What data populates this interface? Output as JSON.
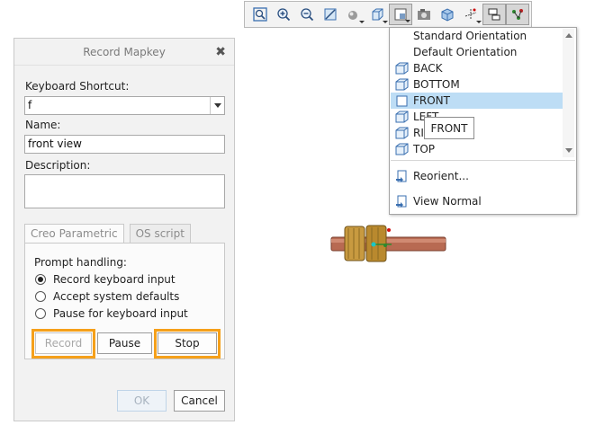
{
  "toolbar": {
    "icons": [
      "zoom-fit-icon",
      "zoom-in-icon",
      "zoom-out-icon",
      "repaint-icon",
      "display-style-icon",
      "saved-orientations-icon",
      "named-views-icon",
      "view-manager-icon",
      "spin-center-icon",
      "datum-display-icon",
      "annotation-display-icon",
      "appearance-icon"
    ]
  },
  "dialog": {
    "title": "Record Mapkey",
    "close_glyph": "✖",
    "shortcut_label": "Keyboard Shortcut:",
    "shortcut_value": "f",
    "name_label": "Name:",
    "name_value": "front view",
    "description_label": "Description:",
    "description_value": "",
    "tabs": [
      {
        "label": "Creo Parametric"
      },
      {
        "label": "OS script"
      }
    ],
    "prompt_label": "Prompt handling:",
    "options": [
      {
        "label": "Record keyboard input",
        "selected": true
      },
      {
        "label": "Accept system defaults",
        "selected": false
      },
      {
        "label": "Pause for keyboard input",
        "selected": false
      }
    ],
    "record_label": "Record",
    "pause_label": "Pause",
    "stop_label": "Stop",
    "ok_label": "OK",
    "cancel_label": "Cancel"
  },
  "menu": {
    "items": [
      {
        "label": "Standard Orientation",
        "icon": ""
      },
      {
        "label": "Default Orientation",
        "icon": ""
      },
      {
        "label": "BACK",
        "icon": "view-cube-icon"
      },
      {
        "label": "BOTTOM",
        "icon": "view-cube-icon"
      },
      {
        "label": "FRONT",
        "icon": "view-front-icon"
      },
      {
        "label": "LEFT",
        "icon": "view-cube-icon"
      },
      {
        "label": "RIGHT",
        "icon": "view-cube-icon"
      },
      {
        "label": "TOP",
        "icon": "view-cube-icon"
      }
    ],
    "reorient_label": "Reorient...",
    "view_normal_label": "View Normal",
    "tooltip": "FRONT"
  },
  "colors": {
    "highlight": "#f5a01a",
    "selected_item": "#bdddf5",
    "shaft": "#b86a52",
    "gear": "#c89a40"
  }
}
